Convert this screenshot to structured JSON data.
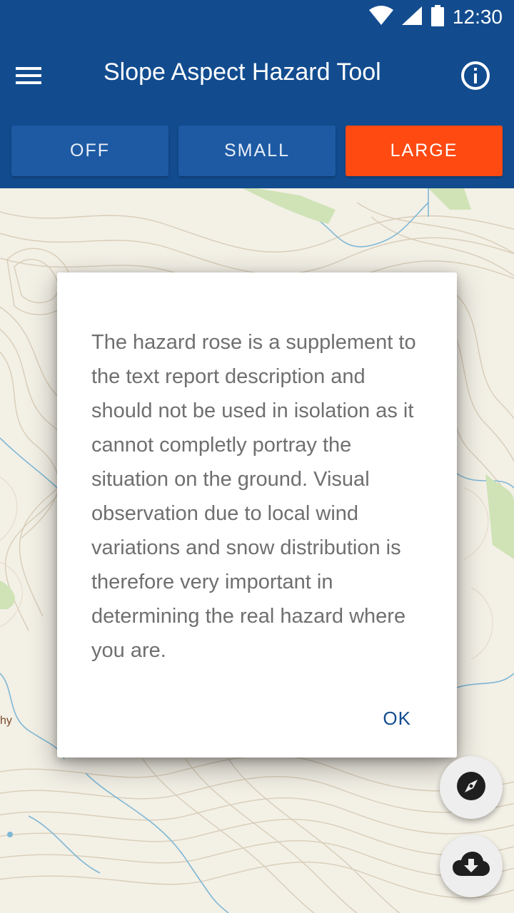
{
  "status_bar": {
    "time": "12:30",
    "icons": [
      "wifi-icon",
      "cell-signal-icon",
      "battery-icon"
    ]
  },
  "app_bar": {
    "title": "Slope Aspect Hazard Tool",
    "menu_icon": "hamburger-menu-icon",
    "info_icon": "info-icon"
  },
  "toggles": [
    {
      "label": "OFF",
      "active": false
    },
    {
      "label": "SMALL",
      "active": false
    },
    {
      "label": "LARGE",
      "active": true
    }
  ],
  "map": {
    "label": "hy"
  },
  "dialog": {
    "message": "The hazard rose is a supplement to the text report description and should not be used in isolation as it cannot completly portray the situation on the ground. Visual observation due to local wind variations and snow distribution is therefore very important in determining the real hazard where you are.",
    "ok_label": "OK"
  },
  "fabs": {
    "compass_icon": "compass-icon",
    "download_icon": "cloud-download-icon"
  },
  "colors": {
    "primary": "#124c8f",
    "toggle": "#1d5aa3",
    "accent": "#ff4a12",
    "map_background": "#f3f0e6",
    "dialog_text": "#6f6f6f"
  }
}
